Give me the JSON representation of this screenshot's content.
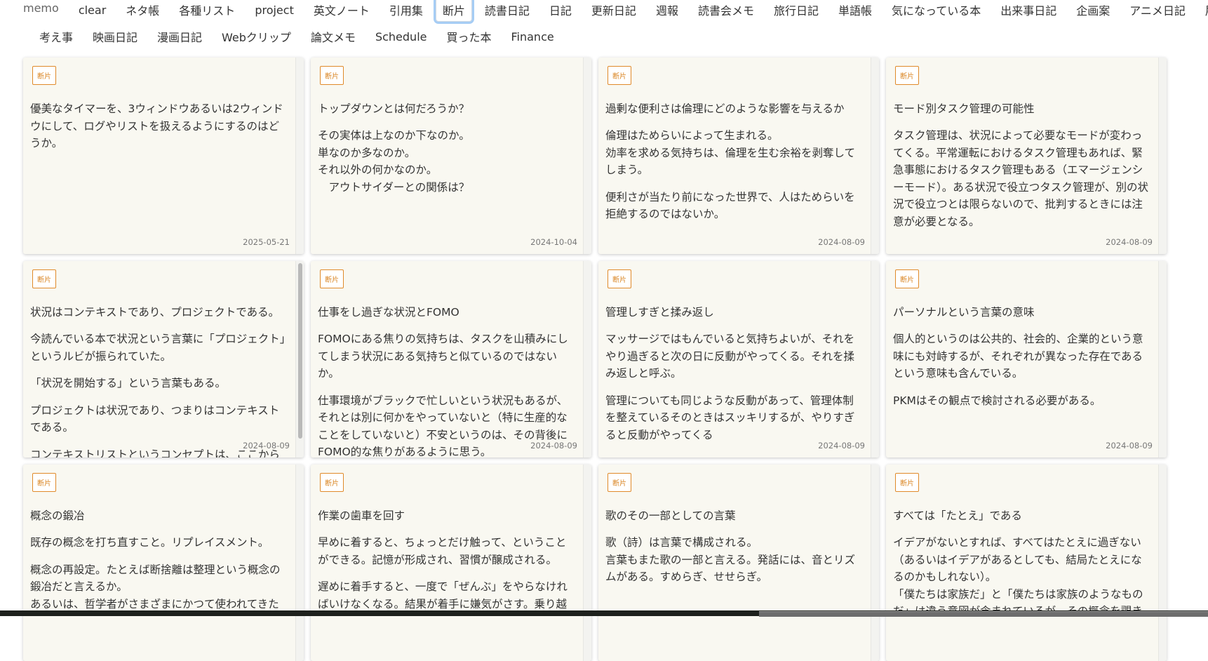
{
  "nav": {
    "brand": "memo",
    "row1": [
      "clear",
      "ネタ帳",
      "各種リスト",
      "project",
      "英文ノート",
      "引用集",
      "断片",
      "読書日記",
      "日記",
      "更新日記",
      "週報",
      "読書会メモ",
      "旅行日記",
      "単語帳",
      "気になっている本",
      "出来事日記",
      "企画案",
      "アニメ日記",
      "展望"
    ],
    "row2": [
      "考え事",
      "映画日記",
      "漫画日記",
      "Webクリップ",
      "論文メモ",
      "Schedule",
      "買った本",
      "Finance"
    ],
    "active": "断片"
  },
  "colors": {
    "badge": "#e08a2a",
    "card_bg": "#f9f8f1",
    "focus": "#a6cdf5"
  },
  "cards": [
    {
      "tag": "断片",
      "title": "",
      "body": [
        "優美なタイマーを、3ウィンドウあるいは2ウィンドウにして、ログやリストを扱えるようにするのはどうか。"
      ],
      "date": "2025-05-21"
    },
    {
      "tag": "断片",
      "title": "トップダウンとは何だろうか？",
      "body": [
        "その実体は上なのか下なのか。\n単なのか多なのか。\nそれ以外の何かなのか。\n　アウトサイダーとの関係は？"
      ],
      "date": "2024-10-04"
    },
    {
      "tag": "断片",
      "title": "過剰な便利さは倫理にどのような影響を与えるか",
      "body": [
        "倫理はためらいによって生まれる。\n効率を求める気持ちは、倫理を生む余裕を剥奪してしまう。",
        "便利さが当たり前になった世界で、人はためらいを拒絶するのではないか。"
      ],
      "date": "2024-08-09"
    },
    {
      "tag": "断片",
      "title": "モード別タスク管理の可能性",
      "body": [
        "タスク管理は、状況によって必要なモードが変わってくる。平常運転におけるタスク管理もあれば、緊急事態におけるタスク管理もある（エマージェンシーモード）。ある状況で役立つタスク管理が、別の状況で役立つとは限らないので、批判するときには注意が必要となる。"
      ],
      "date": "2024-08-09"
    },
    {
      "tag": "断片",
      "title": "状況はコンテキストであり、プロジェクトである。",
      "body": [
        "今読んでいる本で状況という言葉に「プロジェクト」というルビが振られていた。",
        "「状況を開始する」という言葉もある。",
        "プロジェクトは状況であり、つまりはコンテキストである。",
        "コンテキストリストというコンセプトは、ここから"
      ],
      "date": "2024-08-09",
      "scroll": true
    },
    {
      "tag": "断片",
      "title": "仕事をし過ぎな状況とFOMO",
      "body": [
        "FOMOにある焦りの気持ちは、タスクを山積みにしてしまう状況にある気持ちと似ているのではないか。",
        "仕事環境がブラックで忙しいという状況もあるが、それとは別に何かをやっていないと（特に生産的なことをしていないと）不安というのは、その背後にFOMO的な焦りがあるように思う。"
      ],
      "date": "2024-08-09"
    },
    {
      "tag": "断片",
      "title": "管理しすぎと揉み返し",
      "body": [
        "マッサージではもんでいると気持ちよいが、それをやり過ぎると次の日に反動がやってくる。それを揉み返しと呼ぶ。",
        "管理についても同じような反動があって、管理体制を整えているそのときはスッキリするが、やりすぎると反動がやってくる"
      ],
      "date": "2024-08-09"
    },
    {
      "tag": "断片",
      "title": "パーソナルという言葉の意味",
      "body": [
        "個人的というのは公共的、社会的、企業的という意味にも対峙するが、それぞれが異なった存在であるという意味も含んでいる。",
        "PKMはその観点で検討される必要がある。"
      ],
      "date": "2024-08-09"
    },
    {
      "tag": "断片",
      "title": "概念の鍛冶",
      "body": [
        "既存の概念を打ち直すこと。リプレイスメント。",
        "概念の再設定。たとえば断捨離は整理という概念の鍛冶だと言えるか。\nあるいは、哲学者がさまざまにかつて使われてきた"
      ]
    },
    {
      "tag": "断片",
      "title": "作業の歯車を回す",
      "body": [
        "早めに着すると、ちょっとだけ触って、ということができる。記憶が形成され、習慣が醸成される。",
        "遅めに着手すると、一度で「ぜんぶ」をやらなければいけなくなる。結果が着手に嫌気がさす。乗り越"
      ]
    },
    {
      "tag": "断片",
      "title": "歌のその一部としての言葉",
      "body": [
        "歌（詩）は言葉で構成される。\n言葉もまた歌の一部と言える。発話には、音とリズムがある。すめらぎ、せせらぎ。"
      ]
    },
    {
      "tag": "断片",
      "title": "すべては「たとえ」である",
      "body": [
        "イデアがないとすれば、すべてはたとえに過ぎない（あるいはイデアがあるとしても、結局たとえになるのかもしれない）。\n「僕たちは家族だ」と「僕たちは家族のようなものだ」は違う意図が含まれているが、その概念を覗き"
      ]
    }
  ]
}
